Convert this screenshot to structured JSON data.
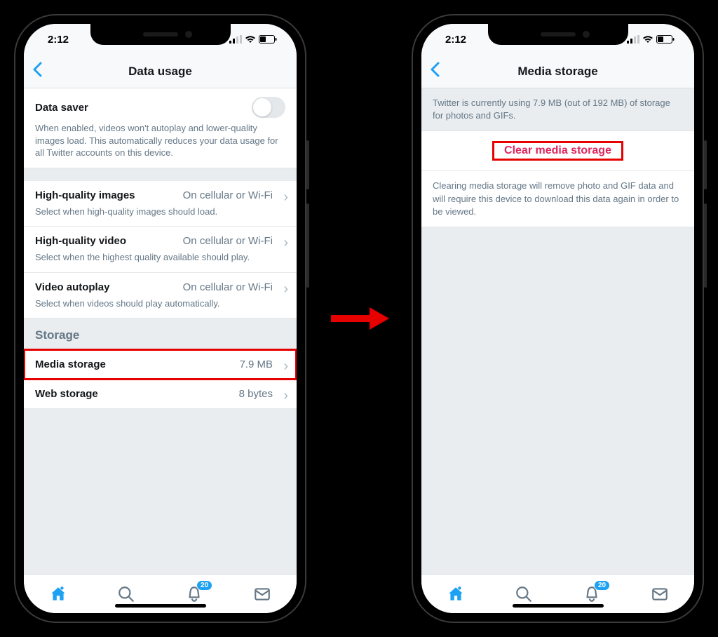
{
  "status": {
    "time": "2:12"
  },
  "left": {
    "title": "Data usage",
    "data_saver": {
      "label": "Data saver",
      "desc": "When enabled, videos won't autoplay and lower-quality images load. This automatically reduces your data usage for all Twitter accounts on this device."
    },
    "hq_images": {
      "label": "High-quality images",
      "value": "On cellular or Wi-Fi",
      "desc": "Select when high-quality images should load."
    },
    "hq_video": {
      "label": "High-quality video",
      "value": "On cellular or Wi-Fi",
      "desc": "Select when the highest quality available should play."
    },
    "autoplay": {
      "label": "Video autoplay",
      "value": "On cellular or Wi-Fi",
      "desc": "Select when videos should play automatically."
    },
    "storage_header": "Storage",
    "media_storage": {
      "label": "Media storage",
      "value": "7.9 MB"
    },
    "web_storage": {
      "label": "Web storage",
      "value": "8 bytes"
    }
  },
  "right": {
    "title": "Media storage",
    "usage_info": "Twitter is currently using 7.9 MB (out of 192 MB) of storage for photos and GIFs.",
    "clear_label": "Clear media storage",
    "clear_desc": "Clearing media storage will remove photo and GIF data and will require this device to download this data again in order to be viewed."
  },
  "tabbar": {
    "badge": "20"
  }
}
